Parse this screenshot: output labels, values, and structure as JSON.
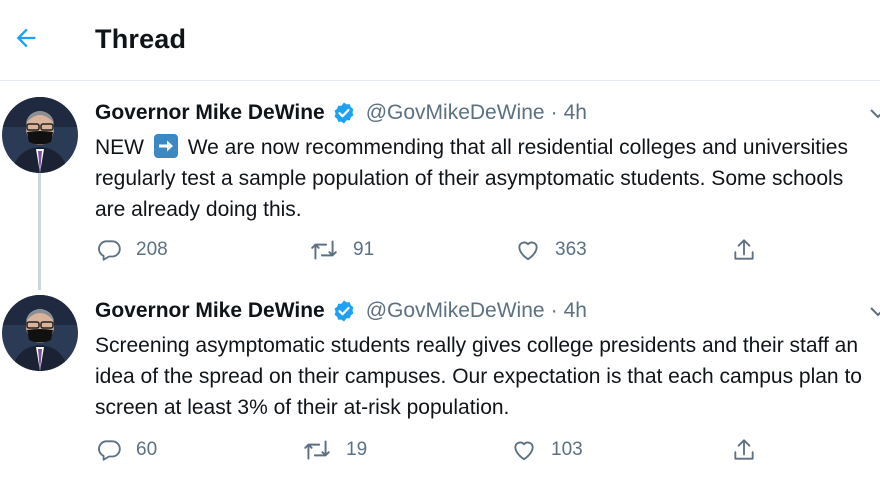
{
  "header": {
    "title": "Thread"
  },
  "tweets": [
    {
      "author": "Governor Mike DeWine",
      "handle": "@GovMikeDeWine",
      "separator": "·",
      "time": "4h",
      "text_prefix": "NEW",
      "emoji": "right-arrow-emoji",
      "text": "We are now recommending that all residential colleges and universities regularly test a sample population of their asymptomatic students. Some schools are already doing this.",
      "replies": "208",
      "retweets": "91",
      "likes": "363"
    },
    {
      "author": "Governor Mike DeWine",
      "handle": "@GovMikeDeWine",
      "separator": "·",
      "time": "4h",
      "text": "Screening asymptomatic students really gives college presidents and their staff an idea of the spread on their campuses. Our expectation is that each campus plan to screen at least 3% of their at-risk population.",
      "replies": "60",
      "retweets": "19",
      "likes": "103"
    }
  ],
  "colors": {
    "accent": "#1da1f2",
    "text": "#0f1419",
    "secondary": "#5b7083",
    "border": "#e6ecf0",
    "thread_line": "#ccd6dd"
  }
}
